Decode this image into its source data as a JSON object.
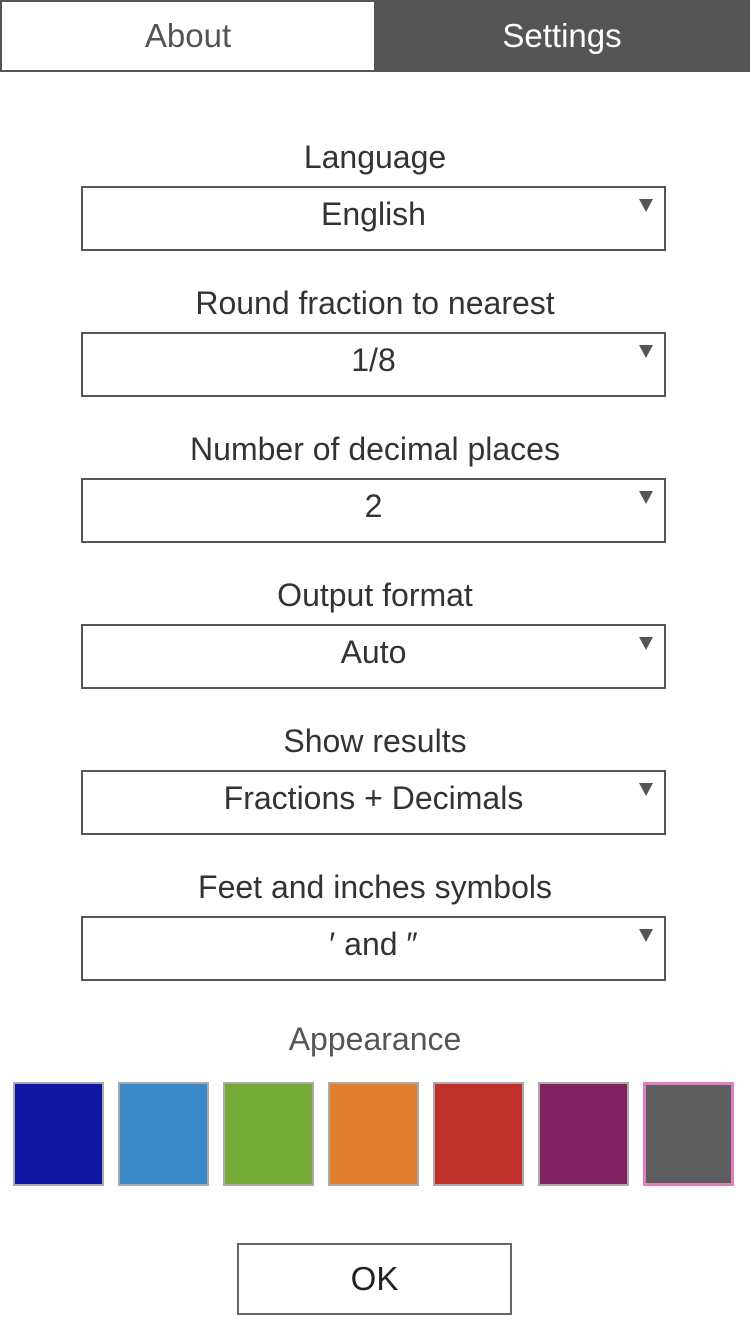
{
  "tabs": [
    {
      "label": "About",
      "active": false
    },
    {
      "label": "Settings",
      "active": true
    }
  ],
  "settings": [
    {
      "label": "Language",
      "value": "English"
    },
    {
      "label": "Round fraction to nearest",
      "value": "1/8"
    },
    {
      "label": "Number of decimal places",
      "value": "2"
    },
    {
      "label": "Output format",
      "value": "Auto"
    },
    {
      "label": "Show results",
      "value": "Fractions + Decimals"
    },
    {
      "label": "Feet and inches symbols",
      "value": "′ and ″"
    }
  ],
  "appearance": {
    "label": "Appearance",
    "selected_index": 6,
    "selected_border_color": "#e07cc0",
    "swatches": [
      {
        "name": "dark-blue",
        "color": "#1117a3"
      },
      {
        "name": "light-blue",
        "color": "#3b88c6"
      },
      {
        "name": "green",
        "color": "#76aa36"
      },
      {
        "name": "orange",
        "color": "#e17f31"
      },
      {
        "name": "red",
        "color": "#c0302a"
      },
      {
        "name": "purple",
        "color": "#7f2260"
      },
      {
        "name": "gray",
        "color": "#5e5e5e"
      }
    ]
  },
  "ok_button": {
    "label": "OK"
  }
}
